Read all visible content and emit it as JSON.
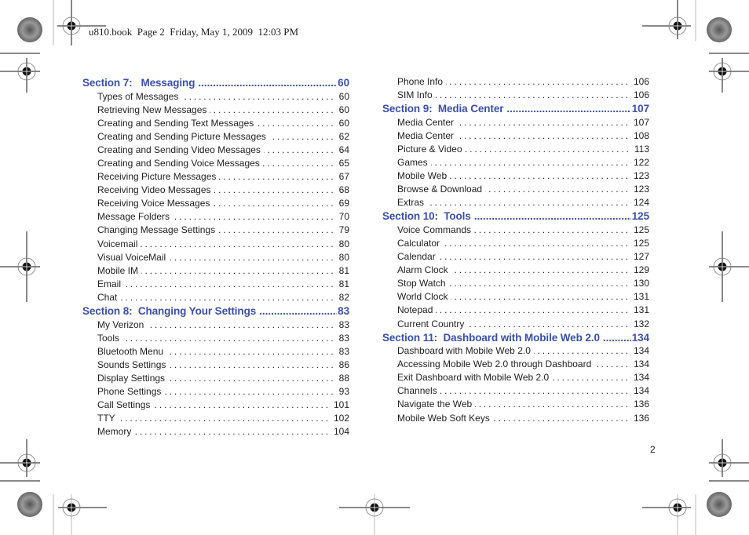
{
  "header": {
    "text": "u810.book  Page 2  Friday, May 1, 2009  12:03 PM"
  },
  "accent_color": "#3a4fb0",
  "left_column": [
    {
      "type": "section",
      "label": "Section 7:   Messaging",
      "page": "60"
    },
    {
      "type": "entry",
      "label": "Types of Messages",
      "page": "60"
    },
    {
      "type": "entry",
      "label": "Retrieving New Messages",
      "page": "60"
    },
    {
      "type": "entry",
      "label": "Creating and Sending Text Messages",
      "page": "60"
    },
    {
      "type": "entry",
      "label": "Creating and Sending Picture Messages",
      "page": "62"
    },
    {
      "type": "entry",
      "label": "Creating and Sending Video Messages",
      "page": "64"
    },
    {
      "type": "entry",
      "label": "Creating and Sending Voice Messages",
      "page": "65"
    },
    {
      "type": "entry",
      "label": "Receiving Picture Messages",
      "page": "67"
    },
    {
      "type": "entry",
      "label": "Receiving Video Messages",
      "page": "68"
    },
    {
      "type": "entry",
      "label": "Receiving Voice Messages",
      "page": "69"
    },
    {
      "type": "entry",
      "label": "Message Folders",
      "page": "70"
    },
    {
      "type": "entry",
      "label": "Changing Message Settings",
      "page": "79"
    },
    {
      "type": "entry",
      "label": "Voicemail",
      "page": "80"
    },
    {
      "type": "entry",
      "label": "Visual VoiceMail",
      "page": "80"
    },
    {
      "type": "entry",
      "label": "Mobile IM",
      "page": "81"
    },
    {
      "type": "entry",
      "label": "Email",
      "page": "81"
    },
    {
      "type": "entry",
      "label": "Chat",
      "page": "82"
    },
    {
      "type": "section",
      "label": "Section 8:  Changing Your Settings",
      "page": "83"
    },
    {
      "type": "entry",
      "label": "My Verizon",
      "page": "83"
    },
    {
      "type": "entry",
      "label": "Tools",
      "page": "83"
    },
    {
      "type": "entry",
      "label": "Bluetooth Menu",
      "page": "83"
    },
    {
      "type": "entry",
      "label": "Sounds Settings",
      "page": "86"
    },
    {
      "type": "entry",
      "label": "Display Settings",
      "page": "88"
    },
    {
      "type": "entry",
      "label": "Phone Settings",
      "page": "93"
    },
    {
      "type": "entry",
      "label": "Call Settings",
      "page": "101"
    },
    {
      "type": "entry",
      "label": "TTY",
      "page": "102"
    },
    {
      "type": "entry",
      "label": "Memory",
      "page": "104"
    }
  ],
  "right_column": [
    {
      "type": "entry",
      "label": "Phone Info",
      "page": "106"
    },
    {
      "type": "entry",
      "label": "SIM Info",
      "page": "106"
    },
    {
      "type": "section",
      "label": "Section 9:  Media Center",
      "page": "107"
    },
    {
      "type": "entry",
      "label": "Media Center",
      "page": "107"
    },
    {
      "type": "entry",
      "label": "Media Center",
      "page": "108"
    },
    {
      "type": "entry",
      "label": "Picture & Video",
      "page": "113"
    },
    {
      "type": "entry",
      "label": "Games",
      "page": "122"
    },
    {
      "type": "entry",
      "label": "Mobile Web",
      "page": "123"
    },
    {
      "type": "entry",
      "label": "Browse & Download",
      "page": "123"
    },
    {
      "type": "entry",
      "label": "Extras",
      "page": "124"
    },
    {
      "type": "section",
      "label": "Section 10:  Tools",
      "page": "125"
    },
    {
      "type": "entry",
      "label": "Voice Commands",
      "page": "125"
    },
    {
      "type": "entry",
      "label": "Calculator",
      "page": "125"
    },
    {
      "type": "entry",
      "label": "Calendar",
      "page": "127"
    },
    {
      "type": "entry",
      "label": "Alarm Clock",
      "page": "129"
    },
    {
      "type": "entry",
      "label": "Stop Watch",
      "page": "130"
    },
    {
      "type": "entry",
      "label": "World Clock",
      "page": "131"
    },
    {
      "type": "entry",
      "label": "Notepad",
      "page": "131"
    },
    {
      "type": "entry",
      "label": "Current Country",
      "page": "132"
    },
    {
      "type": "section",
      "label": "Section 11:  Dashboard with Mobile Web 2.0",
      "page": "134"
    },
    {
      "type": "entry",
      "label": "Dashboard with Mobile Web 2.0",
      "page": "134"
    },
    {
      "type": "entry",
      "label": "Accessing Mobile Web 2.0 through Dashboard",
      "page": "134"
    },
    {
      "type": "entry",
      "label": "Exit Dashboard with Mobile Web 2.0",
      "page": "134"
    },
    {
      "type": "entry",
      "label": "Channels",
      "page": "134"
    },
    {
      "type": "entry",
      "label": "Navigate the Web",
      "page": "136"
    },
    {
      "type": "entry",
      "label": "Mobile Web Soft Keys",
      "page": "136"
    }
  ],
  "footer": {
    "page_number": "2"
  }
}
